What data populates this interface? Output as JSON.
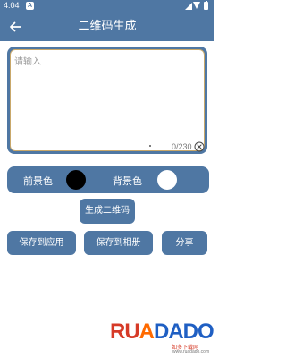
{
  "status_bar": {
    "time": "4:04",
    "notification_badge": "A"
  },
  "app_bar": {
    "title": "二维码生成",
    "back_icon": "arrow-left-icon"
  },
  "input": {
    "placeholder": "请输入",
    "value": "",
    "counter": "0/230",
    "clear_icon": "clear-circle-icon"
  },
  "colors": {
    "foreground_label": "前景色",
    "foreground_color": "#000000",
    "background_label": "背景色",
    "background_color": "#ffffff"
  },
  "buttons": {
    "generate": "生成二维码",
    "save_to_app": "保存到应用",
    "save_to_album": "保存到相册",
    "share": "分享"
  },
  "watermark": {
    "brand": "RUADADO",
    "brand_ru": "RU",
    "brand_a": "A",
    "brand_dado": "DADO",
    "sub": "如多下载网",
    "domain": "www.ruadado.com"
  },
  "theme": {
    "primary": "#4f77a3",
    "input_border": "#c9a86a"
  }
}
